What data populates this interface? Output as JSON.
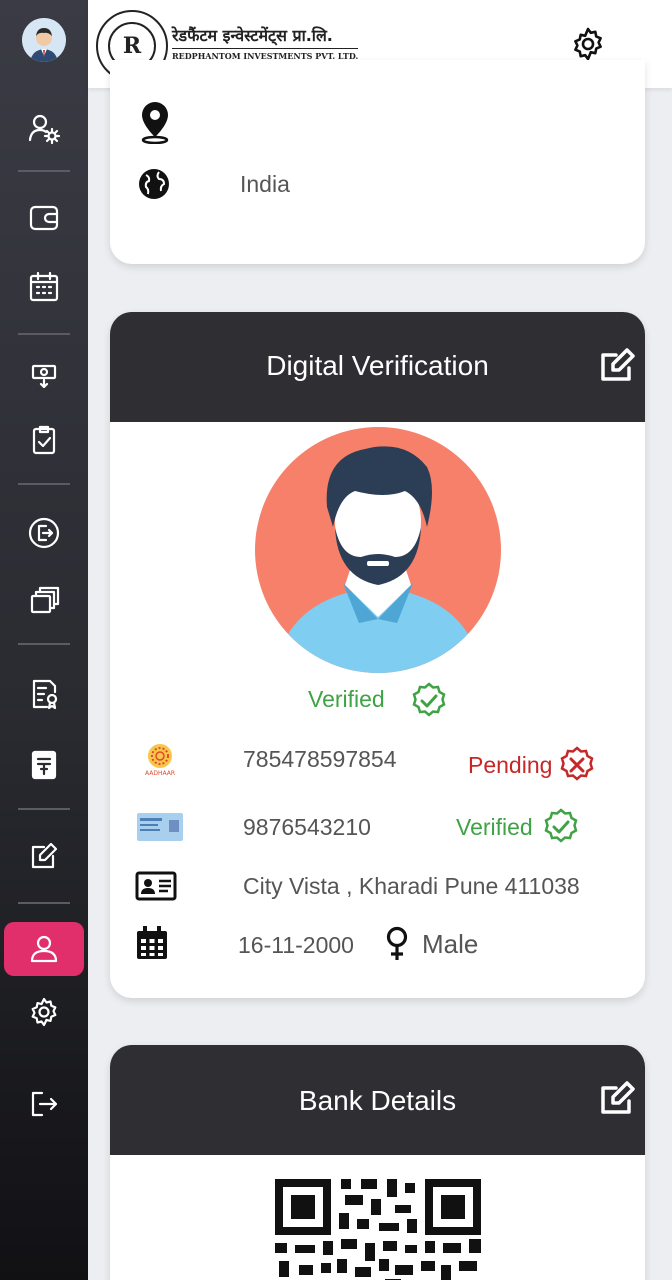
{
  "header": {
    "logo_hindi": "रेडफैंटम इन्वेस्टमेंट्स प्रा.लि.",
    "logo_english": "REDPHANTOM INVESTMENTS PVT. LTD."
  },
  "address_card": {
    "country": "India"
  },
  "digital_verification": {
    "title": "Digital Verification",
    "photo_status": "Verified",
    "aadhaar_logo_text": "AADHAAR",
    "aadhaar_number": "785478597854",
    "aadhaar_status": "Pending",
    "pan_number": "9876543210",
    "pan_status": "Verified",
    "address": "City Vista , Kharadi Pune 411038",
    "dob": "16-11-2000",
    "gender": "Male"
  },
  "bank_details": {
    "title": "Bank Details"
  },
  "colors": {
    "sidebar_active": "#e02f6a",
    "card_header": "#2e2e33",
    "verified": "#3fa345",
    "pending": "#c62828"
  }
}
